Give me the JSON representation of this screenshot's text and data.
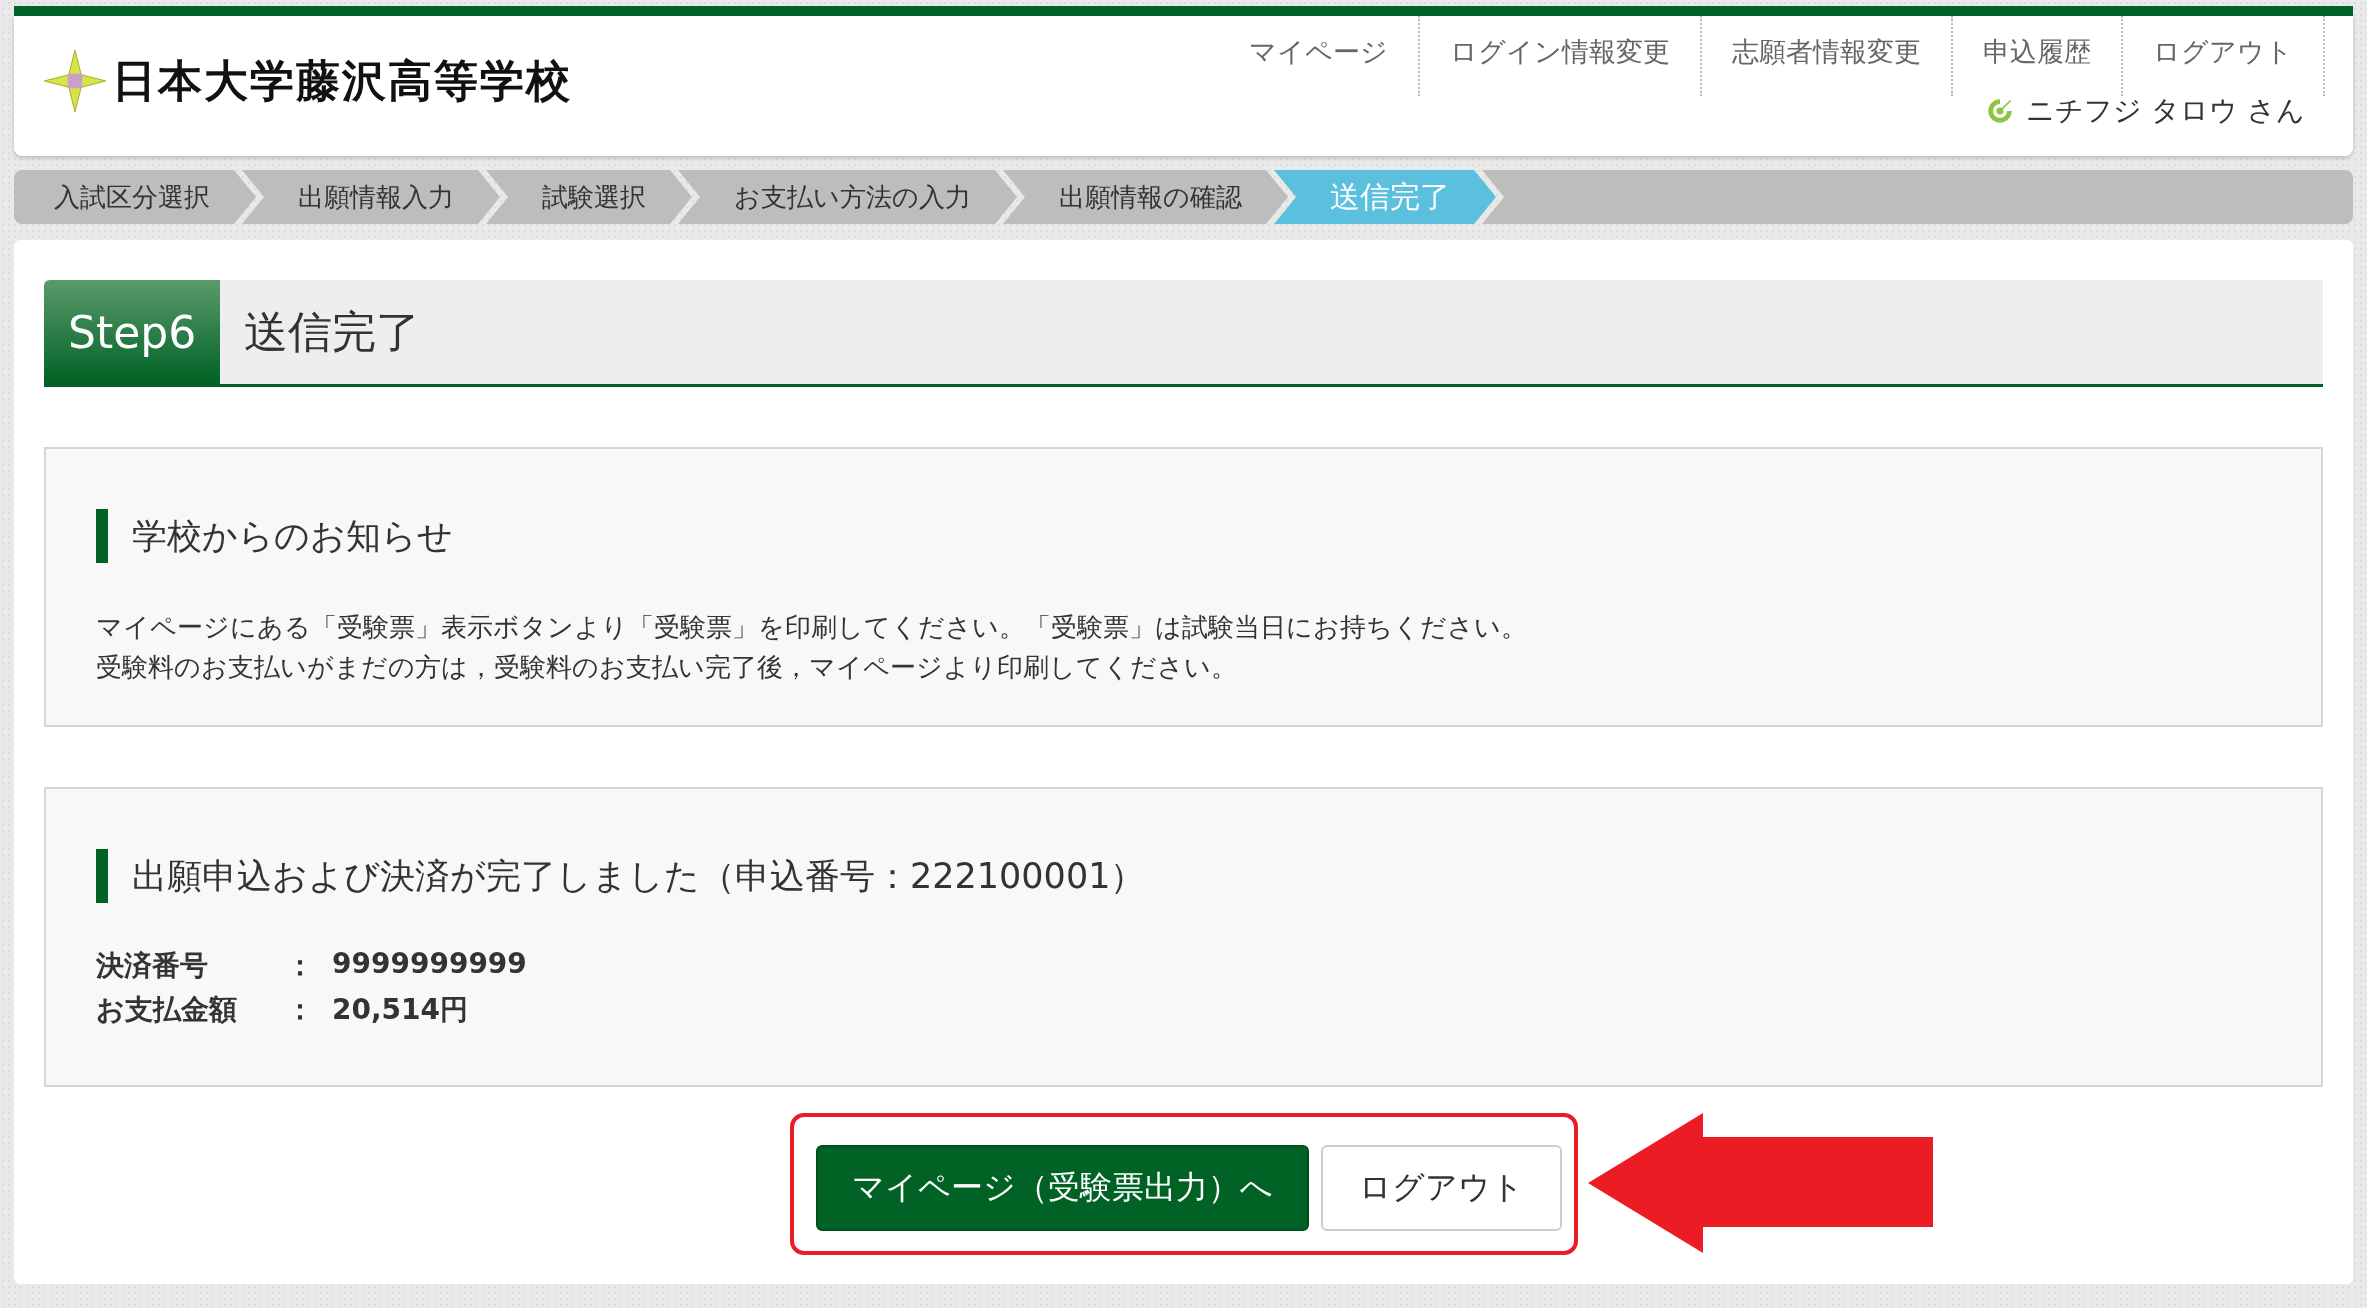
{
  "header": {
    "school_name": "日本大学藤沢高等学校",
    "nav": [
      {
        "label": "マイページ"
      },
      {
        "label": "ログイン情報変更"
      },
      {
        "label": "志願者情報変更"
      },
      {
        "label": "申込履歴"
      },
      {
        "label": "ログアウト"
      }
    ],
    "user_name": "ニチフジ タロウ さん"
  },
  "steps": [
    {
      "label": "入試区分選択",
      "selected": false
    },
    {
      "label": "出願情報入力",
      "selected": false
    },
    {
      "label": "試験選択",
      "selected": false
    },
    {
      "label": "お支払い方法の入力",
      "selected": false
    },
    {
      "label": "出願情報の確認",
      "selected": false
    },
    {
      "label": "送信完了",
      "selected": true
    }
  ],
  "step_heading": {
    "badge": "Step6",
    "title": "送信完了"
  },
  "notice": {
    "heading": "学校からのお知らせ",
    "lines": [
      "マイページにある「受験票」表示ボタンより「受験票」を印刷してください。「受験票」は試験当日にお持ちください。",
      "受験料のお支払いがまだの方は，受験料のお支払い完了後，マイページより印刷してください。"
    ]
  },
  "result": {
    "heading": "出願申込および決済が完了しました（申込番号：222100001）",
    "details": [
      {
        "label": "決済番号",
        "separator": "：",
        "value": "9999999999"
      },
      {
        "label": "お支払金額",
        "separator": "：",
        "value": "20,514円"
      }
    ]
  },
  "buttons": [
    {
      "label": "マイページ（受験票出力）へ",
      "kind": "primary"
    },
    {
      "label": "ログアウト",
      "kind": "secondary"
    }
  ]
}
